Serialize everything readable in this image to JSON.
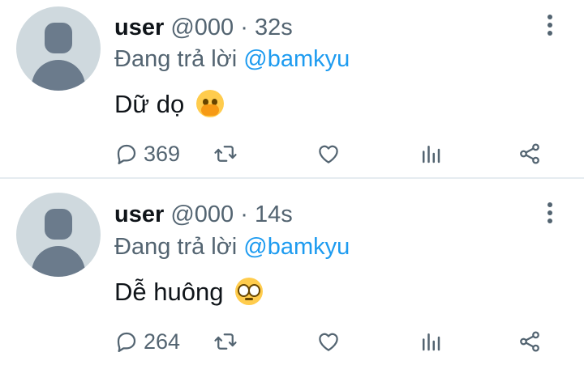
{
  "tweets": [
    {
      "name": "user",
      "handle": "@000",
      "separator": "·",
      "time": "32s",
      "reply_prefix": "Đang trả lời",
      "reply_to": "@bamkyu",
      "text": "Dữ dọ",
      "emoji": "face-with-hand-over-mouth",
      "replies": "369"
    },
    {
      "name": "user",
      "handle": "@000",
      "separator": "·",
      "time": "14s",
      "reply_prefix": "Đang trả lời",
      "reply_to": "@bamkyu",
      "text": "Dễ huông",
      "emoji": "pleading-face",
      "replies": "264"
    }
  ],
  "colors": {
    "text": "#0f1419",
    "muted": "#536471",
    "link": "#1d9bf0",
    "avatar_bg": "#cfd9de",
    "avatar_fg": "#6b7b8c",
    "divider": "#e6ecf0"
  }
}
